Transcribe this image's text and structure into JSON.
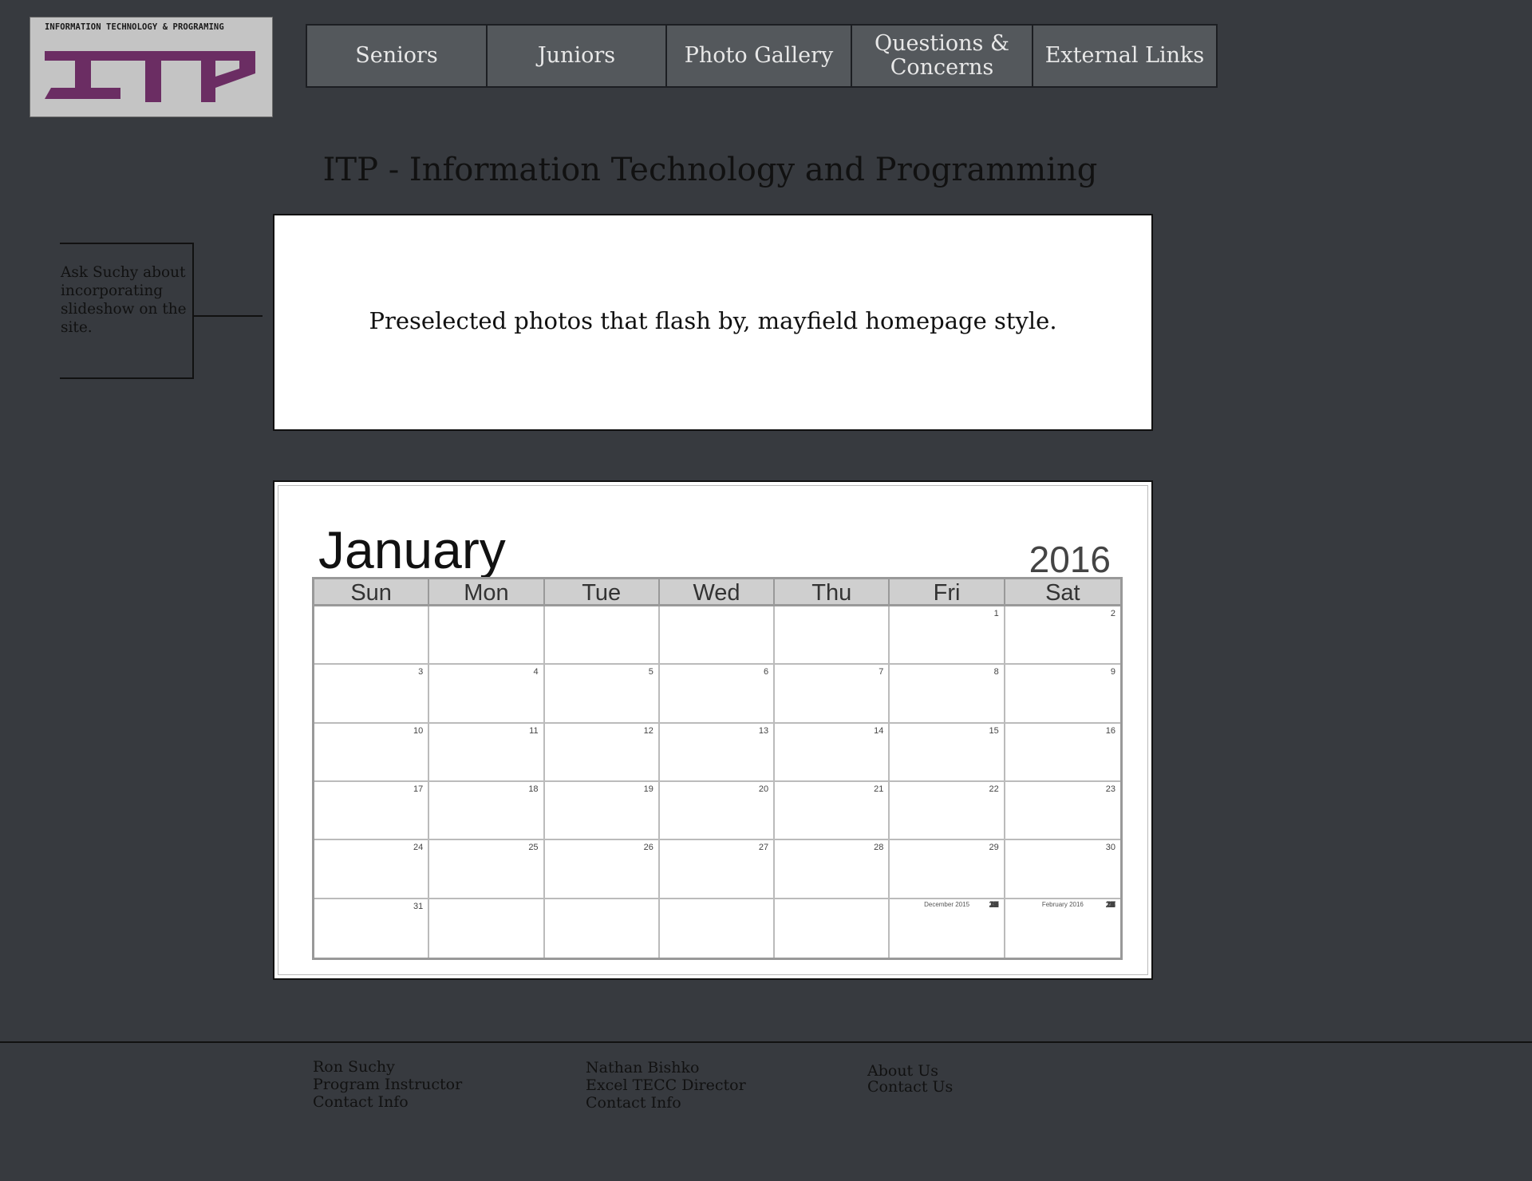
{
  "logo": {
    "tagline": "INFORMATION TECHNOLOGY & PROGRAMING",
    "letters": "ITP",
    "color": "#6b2d63"
  },
  "nav": [
    {
      "label": "Seniors",
      "width": 226
    },
    {
      "label": "Juniors",
      "width": 225
    },
    {
      "label": "Photo Gallery",
      "width": 232
    },
    {
      "label": "Questions & Concerns",
      "width": 227
    },
    {
      "label": "External Links",
      "width": 229
    }
  ],
  "page_title": "ITP - Information Technology and Programming",
  "side_note": "Ask Suchy about incorporating slideshow on the site.",
  "banner": "Preselected photos that flash by, mayfield homepage style.",
  "calendar": {
    "month": "January",
    "year": "2016",
    "weekdays": [
      "Sun",
      "Mon",
      "Tue",
      "Wed",
      "Thu",
      "Fri",
      "Sat"
    ],
    "weeks": [
      [
        "",
        "",
        "",
        "",
        "",
        "1",
        "2"
      ],
      [
        "3",
        "4",
        "5",
        "6",
        "7",
        "8",
        "9"
      ],
      [
        "10",
        "11",
        "12",
        "13",
        "14",
        "15",
        "16"
      ],
      [
        "17",
        "18",
        "19",
        "20",
        "21",
        "22",
        "23"
      ],
      [
        "24",
        "25",
        "26",
        "27",
        "28",
        "29",
        "30"
      ],
      [
        "31",
        "",
        "",
        "",
        "",
        "",
        ""
      ]
    ],
    "mini_prev": {
      "title": "December 2015",
      "days": [
        "S",
        "M",
        "T",
        "W",
        "T",
        "F",
        "S"
      ],
      "rows": [
        [
          "",
          "",
          "1",
          "2",
          "3",
          "4",
          "5"
        ],
        [
          "6",
          "7",
          "8",
          "9",
          "10",
          "11",
          "12"
        ],
        [
          "13",
          "14",
          "15",
          "16",
          "17",
          "18",
          "19"
        ],
        [
          "20",
          "21",
          "22",
          "23",
          "24",
          "25",
          "26"
        ],
        [
          "27",
          "28",
          "29",
          "30",
          "31",
          "",
          ""
        ]
      ]
    },
    "mini_next": {
      "title": "February 2016",
      "days": [
        "S",
        "M",
        "T",
        "W",
        "T",
        "F",
        "S"
      ],
      "rows": [
        [
          "",
          "1",
          "2",
          "3",
          "4",
          "5",
          "6"
        ],
        [
          "7",
          "8",
          "9",
          "10",
          "11",
          "12",
          "13"
        ],
        [
          "14",
          "15",
          "16",
          "17",
          "18",
          "19",
          "20"
        ],
        [
          "21",
          "22",
          "23",
          "24",
          "25",
          "26",
          "27"
        ],
        [
          "28",
          "29",
          "",
          "",
          "",
          "",
          ""
        ]
      ]
    }
  },
  "footer": {
    "col1": [
      "Ron Suchy",
      "Program Instructor",
      "Contact Info"
    ],
    "col2": [
      "Nathan Bishko",
      "Excel TECC Director",
      "Contact Info"
    ],
    "col3": [
      "About Us",
      "Contact Us"
    ]
  }
}
